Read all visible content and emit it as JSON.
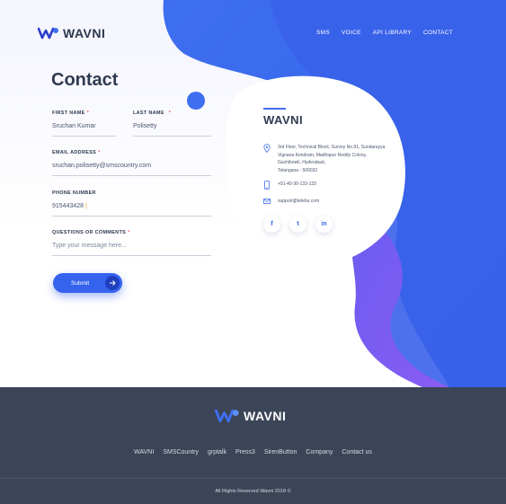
{
  "brand": {
    "name": "WAVNI"
  },
  "nav": {
    "items": [
      "SMS",
      "VOICE",
      "API LIBRARY",
      "CONTACT"
    ]
  },
  "form": {
    "title": "Contact",
    "first_name": {
      "label": "FIRST NAME",
      "required": "*",
      "value": "Sruchan Kumar"
    },
    "last_name": {
      "label": "LAST NAME",
      "required": "*",
      "value": "Polisetty"
    },
    "email": {
      "label": "EMAIL ADDRESS",
      "required": "*",
      "value": "sruchan.polisetty@smscountry.com"
    },
    "phone": {
      "label": "PHONE NUMBER",
      "value": "915443428",
      "caret": "|"
    },
    "comments": {
      "label": "QUESTIONS OR COMMENTS",
      "required": "*",
      "placeholder": "Type your message here..."
    },
    "submit_label": "Submit"
  },
  "contact_card": {
    "brand": "WAVNI",
    "address": [
      "3rd Floor, Technical Block, Survey No.91, Sundarayya",
      "Vignana Kendram, Madhapur Reddy Colony,",
      "Gachibowli, Hyderabad,",
      "Telangana - 500032"
    ],
    "phone": "+91-40-30-133-133",
    "email": "support@telebu.com",
    "socials": [
      {
        "icon": "facebook-icon",
        "glyph": "f"
      },
      {
        "icon": "twitter-icon",
        "glyph": "t"
      },
      {
        "icon": "linkedin-icon",
        "glyph": "in"
      }
    ]
  },
  "footer": {
    "links": [
      "WAVNI",
      "SMSCountry",
      "grptalk",
      "Press3",
      "SirenButton",
      "Company",
      "Contact us"
    ],
    "copyright": "All Rights Reserved Wavni 2018 ©"
  },
  "colors": {
    "accent": "#3563ee",
    "wave_dark": "#3f4fe0",
    "wave_violet": "#7a5cf0",
    "footer": "#3b4557",
    "text": "#2f3b52"
  }
}
